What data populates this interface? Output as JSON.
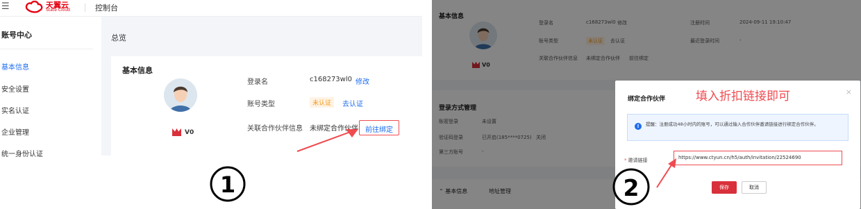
{
  "left": {
    "topbar": {
      "brand_cn": "天翼云",
      "brand_en": "State Cloud",
      "title": "控制台"
    },
    "sidebar": {
      "title": "账号中心",
      "items": [
        {
          "label": "基本信息",
          "active": true
        },
        {
          "label": "安全设置",
          "active": false
        },
        {
          "label": "实名认证",
          "active": false
        },
        {
          "label": "企业管理",
          "active": false
        },
        {
          "label": "统一身份认证",
          "active": false
        }
      ]
    },
    "main": {
      "breadcrumb": "总览",
      "card_title": "基本信息",
      "vip_level": "V0",
      "login_label": "登录名",
      "login_value": "c168273wl0",
      "login_edit": "修改",
      "account_type_label": "账号类型",
      "account_type_tag": "未认证",
      "account_type_action": "去认证",
      "partner_label": "关联合作伙伴信息",
      "partner_value": "未绑定合作伙伴",
      "partner_action": "前往绑定"
    },
    "step_marker": "①"
  },
  "right": {
    "card1": {
      "title": "基本信息",
      "vip_level": "V0",
      "login_label": "登录名",
      "login_value": "c168273wl0",
      "login_edit": "修改",
      "reg_time_label": "注册时间",
      "reg_time_value": "2024-09-11 19:10:47",
      "account_type_label": "账号类型",
      "account_type_tag": "未认证",
      "account_type_action": "去认证",
      "last_login_label": "最近登录时间",
      "last_login_value": "-",
      "partner_label": "关联合作伙伴信息",
      "partner_value": "未绑定合作伙伴",
      "partner_action": "前往绑定"
    },
    "card2": {
      "title": "登录方式管理",
      "rows": [
        {
          "label": "账密登录",
          "value": "未设置",
          "action": ""
        },
        {
          "label": "验证码登录",
          "value": "已开启(185****0725)",
          "action": "关闭"
        },
        {
          "label": "第三方账号",
          "value": "-",
          "action": ""
        }
      ]
    },
    "card3": {
      "tab_active": "基本信息",
      "tab_other": "地址管理"
    },
    "modal": {
      "title": "绑定合作伙伴",
      "hint": "填入折扣链接即可",
      "close": "×",
      "notice": "提醒：注册成功48小时内的账号，可以通过输入合作伙伴邀请链接进行绑定合作伙伴。",
      "field_label": "邀请链接",
      "field_value": "https://www.ctyun.cn/h5/auth/invitation/22524690",
      "save": "保存",
      "cancel": "取消"
    },
    "step_marker": "②"
  },
  "colors": {
    "accent_blue": "#1e6cf0",
    "brand_red": "#e60012",
    "highlight_red": "#ef4b50",
    "warn_orange": "#f39a1e"
  }
}
